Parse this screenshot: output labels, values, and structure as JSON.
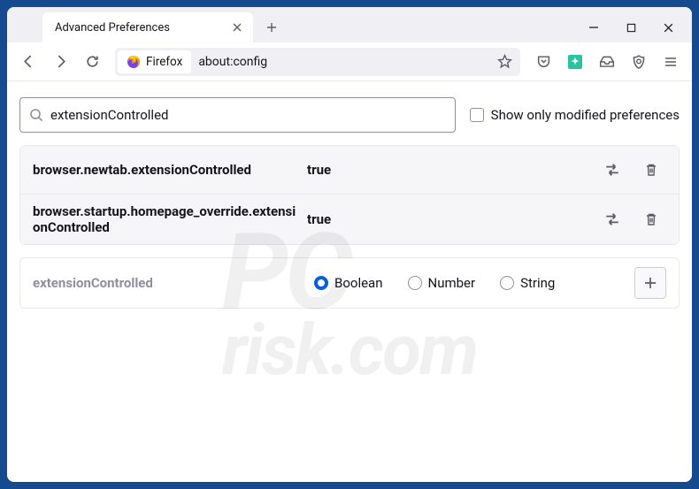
{
  "tabbar": {
    "tab_title": "Advanced Preferences"
  },
  "toolbar": {
    "identity_label": "Firefox",
    "url": "about:config"
  },
  "search": {
    "value": "extensionControlled",
    "checkbox_label": "Show only modified preferences"
  },
  "prefs": [
    {
      "name": "browser.newtab.extensionControlled",
      "value": "true"
    },
    {
      "name": "browser.startup.homepage_override.extensionControlled",
      "value": "true"
    }
  ],
  "newpref": {
    "name": "extensionControlled",
    "types": [
      {
        "label": "Boolean",
        "checked": true
      },
      {
        "label": "Number",
        "checked": false
      },
      {
        "label": "String",
        "checked": false
      }
    ]
  },
  "watermark": {
    "line1": "PC",
    "line2": "risk.com"
  }
}
